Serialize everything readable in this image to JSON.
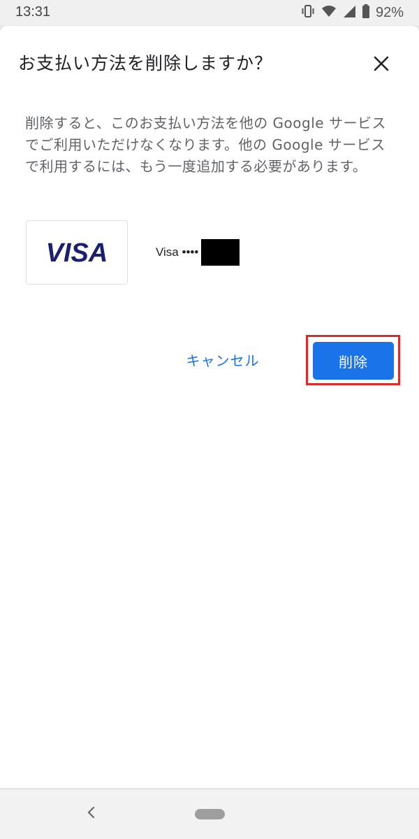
{
  "status_bar": {
    "time": "13:31",
    "battery_percent": "92%",
    "icons": [
      "vibrate-icon",
      "wifi-icon",
      "signal-icon",
      "battery-icon"
    ]
  },
  "dialog": {
    "title": "お支払い方法を削除しますか？",
    "close_icon": "close-icon",
    "description": "削除すると、このお支払い方法を他の Google サービスでご利用いただけなくなります。他の Google サービスで利用するには、もう一度追加する必要があります。",
    "card": {
      "logo_text": "VISA",
      "label": "Visa ••••",
      "logo_color": "#1a1f71"
    },
    "actions": {
      "cancel_label": "キャンセル",
      "delete_label": "削除"
    }
  },
  "colors": {
    "accent": "#1a73e8",
    "highlight": "#d32f2f"
  },
  "nav_bar": {
    "icons": [
      "back-icon",
      "home-pill-icon"
    ]
  }
}
